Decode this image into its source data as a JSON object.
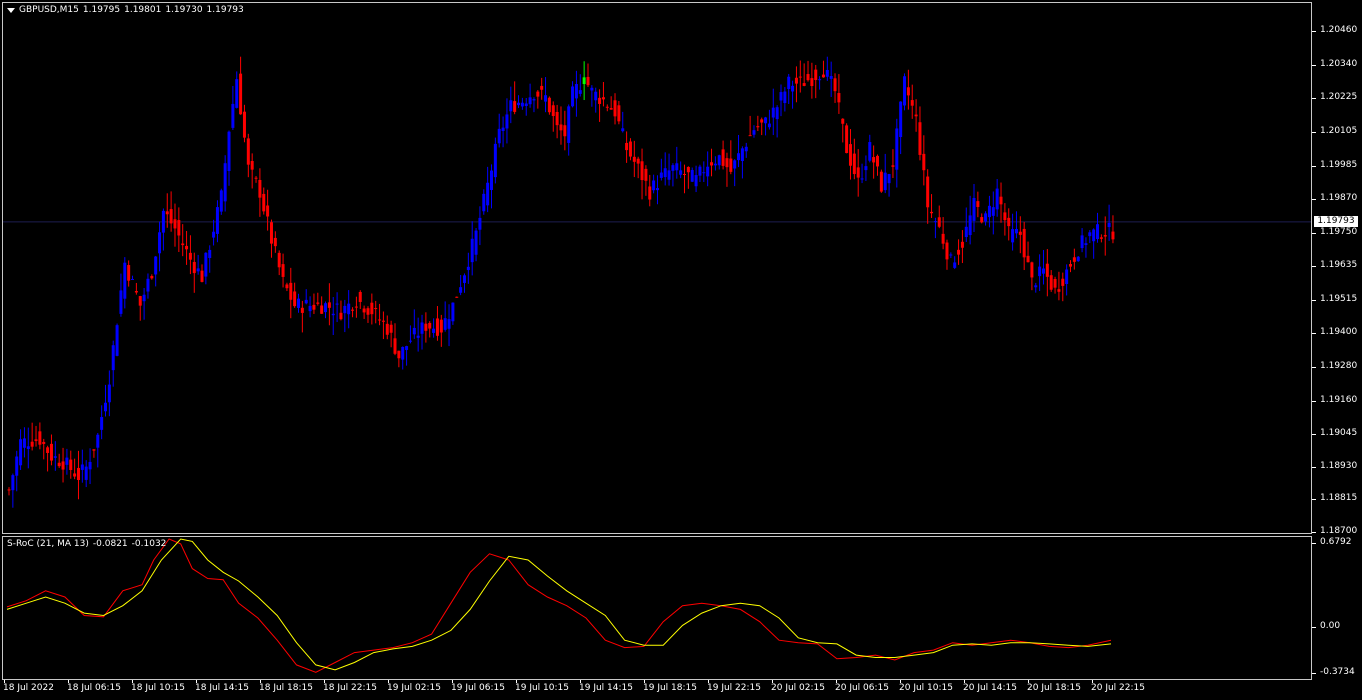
{
  "chart_header": {
    "symbol_tf": "GBPUSD,M15",
    "open": "1.19795",
    "high": "1.19801",
    "low": "1.19730",
    "close": "1.19793"
  },
  "indicator_header": {
    "name": "S-RoC (21, MA 13)",
    "value1": "-0.0821",
    "value2": "-0.1032"
  },
  "current_price_label": "1.19793",
  "colors": {
    "background": "#000000",
    "bull_candle": "#0000ff",
    "bear_candle": "#ff0000",
    "doji_candle": "#00ff00",
    "roc_line": "#ff0000",
    "ma_line": "#ffff00",
    "grid_line": "#1e1e50"
  },
  "price_axis": {
    "labels": [
      "1.20460",
      "1.20340",
      "1.20225",
      "1.20105",
      "1.19985",
      "1.19870",
      "1.19750",
      "1.19635",
      "1.19515",
      "1.19400",
      "1.19280",
      "1.19160",
      "1.19045",
      "1.18930",
      "1.18815",
      "1.18700"
    ],
    "min": 1.187,
    "max": 1.2046
  },
  "oscillator_axis": {
    "labels": [
      "0.6792",
      "0.00",
      "-0.3734"
    ],
    "max": 0.6792,
    "min": -0.3734
  },
  "time_axis": {
    "labels": [
      "18 Jul 2022",
      "18 Jul 06:15",
      "18 Jul 10:15",
      "18 Jul 14:15",
      "18 Jul 18:15",
      "18 Jul 22:15",
      "19 Jul 02:15",
      "19 Jul 06:15",
      "19 Jul 10:15",
      "19 Jul 14:15",
      "19 Jul 18:15",
      "19 Jul 22:15",
      "20 Jul 02:15",
      "20 Jul 06:15",
      "20 Jul 10:15",
      "20 Jul 14:15",
      "20 Jul 18:15",
      "20 Jul 22:15"
    ]
  },
  "chart_data": [
    {
      "type": "candlestick",
      "title": "GBPUSD,M15",
      "ylim": [
        1.187,
        1.2046
      ],
      "anchors": [
        [
          0,
          1.1885
        ],
        [
          3,
          1.1902
        ],
        [
          8,
          1.1903
        ],
        [
          11,
          1.1897
        ],
        [
          14,
          1.1895
        ],
        [
          18,
          1.189
        ],
        [
          20,
          1.1893
        ],
        [
          23,
          1.1904
        ],
        [
          26,
          1.1925
        ],
        [
          30,
          1.1965
        ],
        [
          34,
          1.195
        ],
        [
          37,
          1.1962
        ],
        [
          40,
          1.1983
        ],
        [
          43,
          1.1977
        ],
        [
          47,
          1.1966
        ],
        [
          50,
          1.196
        ],
        [
          53,
          1.1977
        ],
        [
          55,
          1.1988
        ],
        [
          57,
          1.2012
        ],
        [
          59,
          1.203
        ],
        [
          62,
          1.1998
        ],
        [
          65,
          1.199
        ],
        [
          68,
          1.1973
        ],
        [
          71,
          1.1958
        ],
        [
          74,
          1.195
        ],
        [
          78,
          1.195
        ],
        [
          82,
          1.195
        ],
        [
          86,
          1.1948
        ],
        [
          90,
          1.1952
        ],
        [
          94,
          1.1948
        ],
        [
          98,
          1.1942
        ],
        [
          101,
          1.1932
        ],
        [
          104,
          1.1938
        ],
        [
          108,
          1.1943
        ],
        [
          112,
          1.1942
        ],
        [
          115,
          1.195
        ],
        [
          118,
          1.1962
        ],
        [
          121,
          1.1975
        ],
        [
          124,
          1.1992
        ],
        [
          127,
          1.201
        ],
        [
          130,
          1.202
        ],
        [
          133,
          1.2022
        ],
        [
          136,
          1.2025
        ],
        [
          139,
          1.2023
        ],
        [
          142,
          1.2012
        ],
        [
          144,
          1.201
        ],
        [
          146,
          1.2024
        ],
        [
          149,
          1.203
        ],
        [
          151,
          1.2025
        ],
        [
          154,
          1.2022
        ],
        [
          157,
          1.2018
        ],
        [
          160,
          1.2005
        ],
        [
          163,
          1.1998
        ],
        [
          166,
          1.199
        ],
        [
          169,
          1.1995
        ],
        [
          172,
          1.1998
        ],
        [
          175,
          1.1996
        ],
        [
          178,
          1.1994
        ],
        [
          181,
          1.2
        ],
        [
          184,
          1.2002
        ],
        [
          187,
          1.1997
        ],
        [
          190,
          1.2005
        ],
        [
          193,
          1.2012
        ],
        [
          196,
          1.2014
        ],
        [
          199,
          1.202
        ],
        [
          202,
          1.2028
        ],
        [
          205,
          1.2028
        ],
        [
          208,
          1.203
        ],
        [
          211,
          1.2033
        ],
        [
          214,
          1.2025
        ],
        [
          217,
          1.2005
        ],
        [
          220,
          1.1993
        ],
        [
          223,
          1.2005
        ],
        [
          226,
          1.1992
        ],
        [
          229,
          1.2
        ],
        [
          232,
          1.2028
        ],
        [
          235,
          1.2015
        ],
        [
          238,
          1.1985
        ],
        [
          241,
          1.1977
        ],
        [
          244,
          1.1965
        ],
        [
          247,
          1.1972
        ],
        [
          250,
          1.1985
        ],
        [
          253,
          1.198
        ],
        [
          256,
          1.199
        ],
        [
          259,
          1.1975
        ],
        [
          262,
          1.1975
        ],
        [
          265,
          1.1958
        ],
        [
          268,
          1.1962
        ],
        [
          271,
          1.1955
        ],
        [
          274,
          1.1962
        ],
        [
          277,
          1.197
        ],
        [
          280,
          1.1975
        ],
        [
          283,
          1.1976
        ],
        [
          286,
          1.1976
        ]
      ],
      "last_close": 1.19793
    },
    {
      "type": "line",
      "title": "S-RoC (21, MA 13)",
      "ylim": [
        -0.3734,
        0.6792
      ],
      "series": [
        {
          "name": "S-RoC",
          "x": [
            0,
            5,
            10,
            15,
            20,
            25,
            30,
            35,
            38,
            42,
            45,
            48,
            52,
            56,
            60,
            65,
            70,
            75,
            80,
            85,
            90,
            95,
            100,
            105,
            110,
            115,
            120,
            125,
            130,
            135,
            140,
            145,
            150,
            155,
            160,
            165,
            170,
            175,
            180,
            185,
            190,
            195,
            200,
            205,
            210,
            215,
            220,
            225,
            230,
            235,
            240,
            245,
            250,
            255,
            260,
            265,
            270,
            275,
            280,
            286
          ],
          "values": [
            0.17,
            0.22,
            0.3,
            0.25,
            0.1,
            0.09,
            0.3,
            0.35,
            0.55,
            0.72,
            0.68,
            0.48,
            0.4,
            0.39,
            0.2,
            0.08,
            -0.1,
            -0.3,
            -0.36,
            -0.28,
            -0.2,
            -0.18,
            -0.16,
            -0.12,
            -0.05,
            0.2,
            0.45,
            0.6,
            0.55,
            0.35,
            0.25,
            0.18,
            0.08,
            -0.1,
            -0.16,
            -0.15,
            0.05,
            0.18,
            0.2,
            0.18,
            0.15,
            0.05,
            -0.1,
            -0.12,
            -0.13,
            -0.25,
            -0.24,
            -0.22,
            -0.26,
            -0.2,
            -0.18,
            -0.12,
            -0.14,
            -0.12,
            -0.1,
            -0.12,
            -0.15,
            -0.16,
            -0.14,
            -0.1
          ]
        },
        {
          "name": "MA 13",
          "x": [
            0,
            5,
            10,
            15,
            20,
            25,
            30,
            35,
            40,
            45,
            48,
            52,
            56,
            60,
            65,
            70,
            75,
            80,
            85,
            90,
            95,
            100,
            105,
            110,
            115,
            120,
            125,
            130,
            135,
            140,
            145,
            150,
            155,
            160,
            165,
            170,
            175,
            180,
            185,
            190,
            195,
            200,
            205,
            210,
            215,
            220,
            225,
            230,
            235,
            240,
            245,
            250,
            255,
            260,
            265,
            270,
            275,
            280,
            286
          ],
          "values": [
            0.15,
            0.2,
            0.25,
            0.2,
            0.12,
            0.1,
            0.18,
            0.3,
            0.55,
            0.72,
            0.7,
            0.55,
            0.45,
            0.38,
            0.25,
            0.1,
            -0.12,
            -0.3,
            -0.34,
            -0.28,
            -0.2,
            -0.17,
            -0.15,
            -0.1,
            -0.02,
            0.15,
            0.38,
            0.58,
            0.55,
            0.42,
            0.3,
            0.2,
            0.1,
            -0.1,
            -0.14,
            -0.14,
            0.02,
            0.12,
            0.18,
            0.2,
            0.18,
            0.08,
            -0.08,
            -0.12,
            -0.13,
            -0.22,
            -0.24,
            -0.24,
            -0.22,
            -0.2,
            -0.14,
            -0.13,
            -0.14,
            -0.12,
            -0.12,
            -0.13,
            -0.14,
            -0.15,
            -0.13
          ]
        }
      ]
    }
  ]
}
